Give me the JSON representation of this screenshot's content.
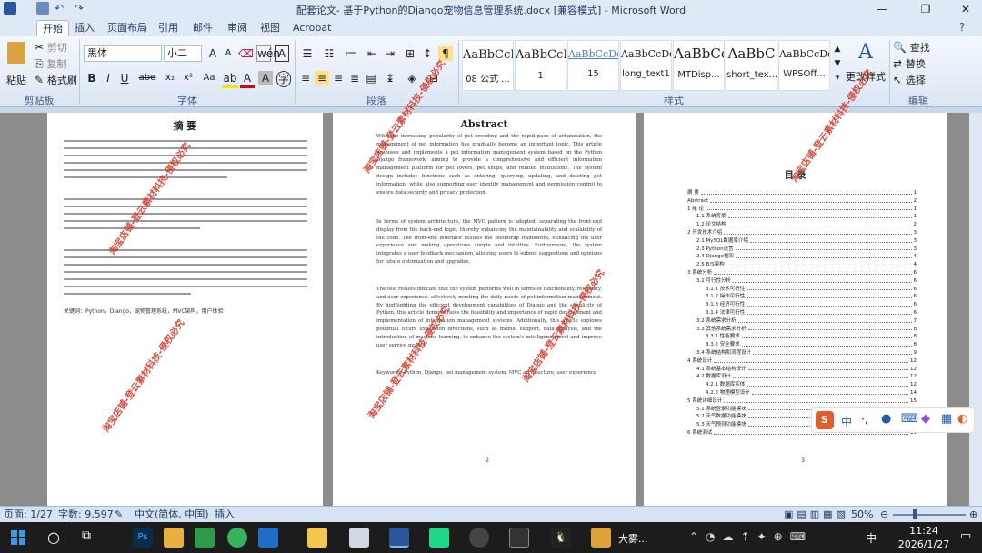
{
  "window": {
    "title": "配套论文- 基于Python的Django宠物信息管理系统.docx [兼容模式] - Microsoft Word"
  },
  "tabs": [
    "开始",
    "插入",
    "页面布局",
    "引用",
    "邮件",
    "审阅",
    "视图",
    "Acrobat"
  ],
  "ribbon": {
    "clipboard": {
      "paste": "粘贴",
      "cut": "剪切",
      "copy": "复制",
      "format_painter": "格式刷",
      "label": "剪贴板"
    },
    "font": {
      "name": "黑体",
      "size": "小二",
      "label": "字体"
    },
    "paragraph": {
      "label": "段落"
    },
    "styles": {
      "items": [
        {
          "sample": "AaBbCcI",
          "name": "08 公式 ..."
        },
        {
          "sample": "AaBbCcI",
          "name": "1"
        },
        {
          "sample": "AaBbCcDdI",
          "name": "15"
        },
        {
          "sample": "AaBbCcDd",
          "name": "long_text1"
        },
        {
          "sample": "AaBbCc",
          "name": "MTDisp..."
        },
        {
          "sample": "AaBbC",
          "name": "short_tex..."
        },
        {
          "sample": "AaBbCcDd",
          "name": "WPSOff..."
        }
      ],
      "change_styles": "更改样式",
      "label": "样式"
    },
    "editing": {
      "find": "查找",
      "replace": "替换",
      "select": "选择",
      "label": "编辑"
    }
  },
  "pages": {
    "page1": {
      "heading": "摘  要",
      "keywords": "关键词：Python，Django，宠物管理系统，MVC架构，用户体验"
    },
    "page2": {
      "heading": "Abstract",
      "p1": "With the increasing popularity of pet breeding and the rapid pace of urbanization, the management of pet information has gradually become an important topic. This article proposes and implements a pet information management system based on the Python Django framework, aiming to provide a comprehensive and efficient information management platform for pet lovers, pet shops, and related institutions. The system design includes functions such as entering, querying, updating, and deleting pet information, while also supporting user identity management and permission control to ensure data security and privacy protection.",
      "p2": "In terms of system architecture, the MVC pattern is adopted, separating the front-end display from the back-end logic, thereby enhancing the maintainability and scalability of the code. The front-end interface utilizes the Bootstrap framework, enhancing the user experience and making operations simple and intuitive. Furthermore, the system integrates a user feedback mechanism, allowing users to submit suggestions and opinions for future optimization and upgrades.",
      "p3": "The test results indicate that the system performs well in terms of functionality, reliability, and user experience, effectively meeting the daily needs of pet information management. By highlighting the efficient development capabilities of Django and the simplicity of Python, this article demonstrates the feasibility and importance of rapid development and implementation of information management systems. Additionally, this article explores potential future expansion directions, such as mobile support, data analysis, and the introduction of machine learning, to enhance the system's intelligence level and improve user service quality.",
      "keywords": "Keywords: Python, Django, pet management system, MVC architecture, user experience"
    },
    "page3": {
      "heading": "目  录",
      "toc": [
        {
          "t": "摘  要",
          "p": "1"
        },
        {
          "t": "Abstract",
          "p": "2"
        },
        {
          "t": "1  绪  论",
          "p": "1"
        },
        {
          "t": "1.1 系统背景",
          "p": "1"
        },
        {
          "t": "1.2 论文结构",
          "p": "2"
        },
        {
          "t": "2  开发技术介绍",
          "p": "3"
        },
        {
          "t": "2.1 MySQL数据库介绍",
          "p": "3"
        },
        {
          "t": "2.3 Python语言",
          "p": "3"
        },
        {
          "t": "2.4 Django框架",
          "p": "4"
        },
        {
          "t": "2.5 B/S架构",
          "p": "4"
        },
        {
          "t": "3  系统分析",
          "p": "6"
        },
        {
          "t": "3.1 可行性分析",
          "p": "6"
        },
        {
          "t": "3.1.1 技术可行性",
          "p": "6"
        },
        {
          "t": "3.1.2 操作可行性",
          "p": "6"
        },
        {
          "t": "3.1.3 经济可行性",
          "p": "6"
        },
        {
          "t": "3.1.4 法律可行性",
          "p": "6"
        },
        {
          "t": "3.2 系统需求分析",
          "p": "7"
        },
        {
          "t": "3.3 其他系统需求分析",
          "p": "8"
        },
        {
          "t": "3.3.1 性能要求",
          "p": "8"
        },
        {
          "t": "3.3.2 安全要求",
          "p": "8"
        },
        {
          "t": "3.4   系统结构和流程设计",
          "p": "9"
        },
        {
          "t": "4 系统设计",
          "p": "12"
        },
        {
          "t": "4.1   系统基本结构设计",
          "p": "12"
        },
        {
          "t": "4.2 数据库设计",
          "p": "12"
        },
        {
          "t": "4.2.1 数据库实体",
          "p": "12"
        },
        {
          "t": "4.2.2 物理模型设计",
          "p": "14"
        },
        {
          "t": "5 系统详细设计",
          "p": "15"
        },
        {
          "t": "5.1 系统登录功能模块",
          "p": "15"
        },
        {
          "t": "5.2 天气数据功能模块",
          "p": "16"
        },
        {
          "t": "5.3 天气预测功能模块",
          "p": "17"
        },
        {
          "t": "6 系统测试",
          "p": "19"
        }
      ],
      "page_number": "3"
    },
    "page2_number": "2"
  },
  "watermark": "淘宝店铺-登云素材科技-侵权必究",
  "statusbar": {
    "page": "页面: 1/27",
    "words": "字数: 9,597",
    "language": "中文(简体, 中国)",
    "insert": "插入",
    "zoom": "50%"
  },
  "taskbar": {
    "time": "11:24",
    "date": "2026/1/27",
    "ime": "中",
    "app_label": "大雾..."
  }
}
